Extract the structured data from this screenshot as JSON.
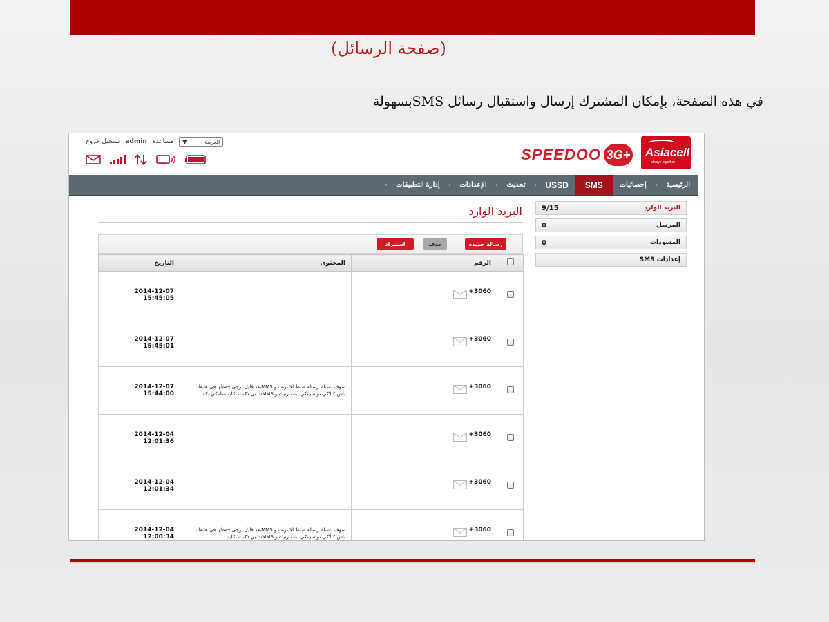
{
  "slide": {
    "title": "(صفحة الرسائل)",
    "description": "في هذه الصفحة، بإمكان المشترك إرسال واستقبال رسائل SMSبسهولة"
  },
  "header": {
    "logout": "تسجيل خروج",
    "user": "admin",
    "help": "مساعدة",
    "language": "العربية",
    "brand_product": "SPEEDOO",
    "brand_badge": "3G+",
    "brand_operator": "Asiacell",
    "brand_tagline": "always together"
  },
  "status_icons": [
    "mail-icon",
    "signal-icon",
    "data-transfer-icon",
    "wifi-device-icon",
    "battery-icon"
  ],
  "nav": {
    "items": [
      {
        "label": "الرئيسية"
      },
      {
        "label": "إحصائيات"
      },
      {
        "label": "SMS",
        "active": true
      },
      {
        "label": "USSD"
      },
      {
        "label": "تحديث"
      },
      {
        "label": "الإعدادات"
      },
      {
        "label": "إدارة التطبيقات"
      }
    ]
  },
  "page": {
    "title": "البريد الوارد"
  },
  "sidebar": {
    "items": [
      {
        "name": "البريد الوارد",
        "count": "9/15"
      },
      {
        "name": "المرسل",
        "count": "0"
      },
      {
        "name": "المسودات",
        "count": "0"
      },
      {
        "name": "إعدادات SMS",
        "count": ""
      }
    ]
  },
  "toolbar": {
    "new_message": "رسالة جديدة",
    "delete": "حذف",
    "import": "استيراد"
  },
  "table": {
    "headers": {
      "number": "الرقم",
      "content": "المحتوى",
      "date": "التاريخ"
    },
    "rows": [
      {
        "number": "+3060",
        "content": "",
        "date": "2014-12-07 15:45:05"
      },
      {
        "number": "+3060",
        "content": "",
        "date": "2014-12-07 15:45:01"
      },
      {
        "number": "+3060",
        "content": "سوف تستلم رسالة ضبط الانترنت و MMSبعد قليل.يرجى حفظها في هاتفك. \nبأش كالاكي تو سيتنكي لينتة رنيت و MMSت بي ذكتت تكاية ساتيكي بكة",
        "date": "2014-12-07 15:44:00"
      },
      {
        "number": "+3060",
        "content": "",
        "date": "2014-12-04 12:01:36"
      },
      {
        "number": "+3060",
        "content": "",
        "date": "2014-12-04 12:01:34"
      },
      {
        "number": "+3060",
        "content": "سوف تستلم رسالة ضبط الانترنت و MMSبعد قليل.يرجى حفظها في هاتفك. \nبأش كالاكي تو سيتنكي لينتة رنيت و MMSت بي ذكتت تكاية",
        "date": "2014-12-04 12:00:34"
      }
    ]
  },
  "colors": {
    "slide_accent": "#ad0000",
    "brand_red": "#d30a1e",
    "nav_bg": "#5d6a72",
    "nav_active": "#a1141c"
  }
}
